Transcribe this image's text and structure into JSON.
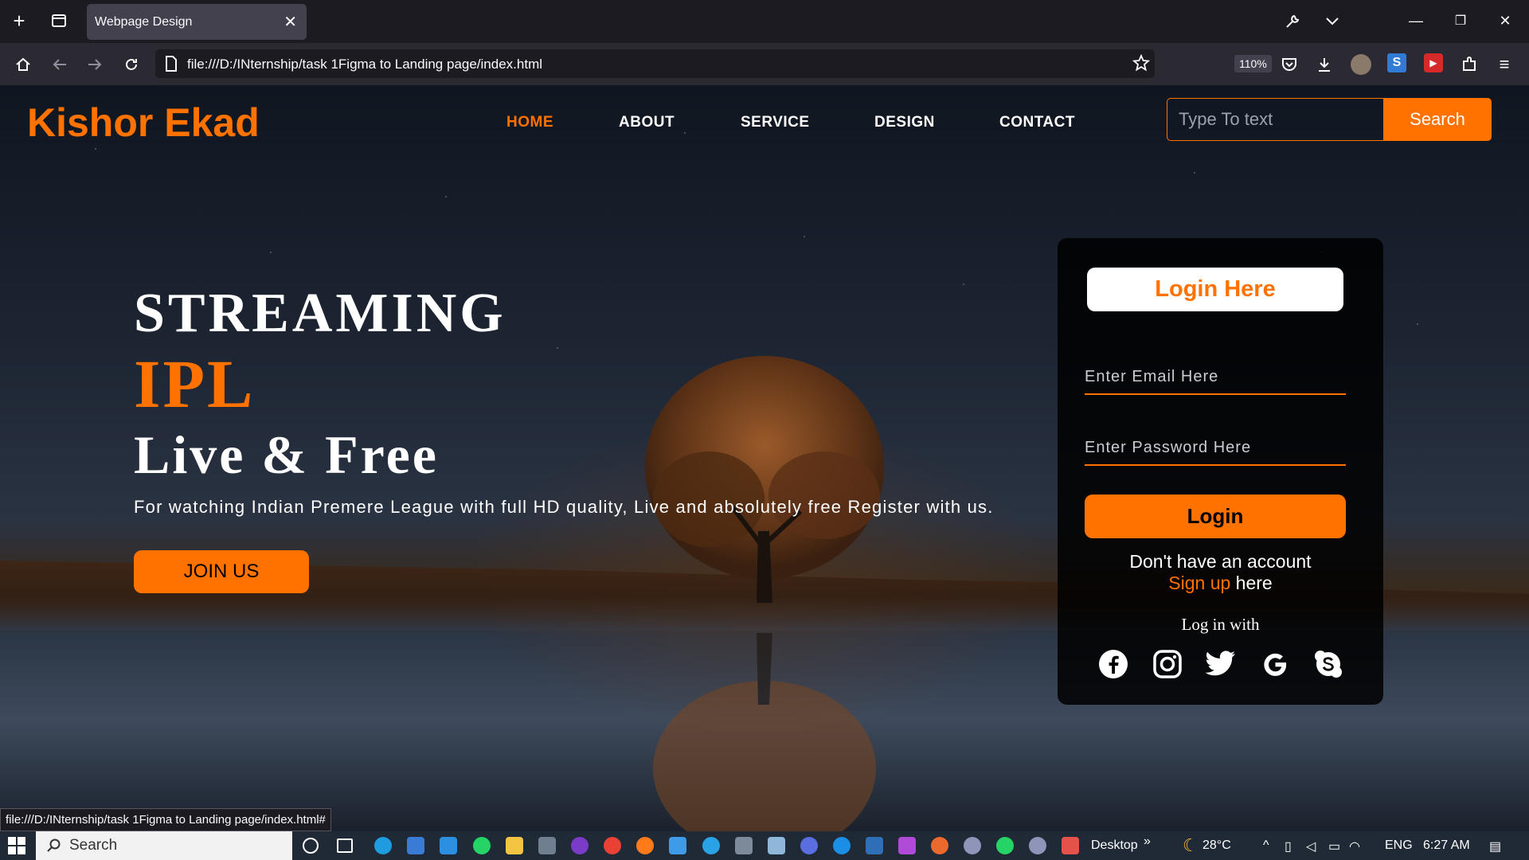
{
  "browser": {
    "tab_title": "Webpage Design",
    "url": "file:///D:/INternship/task 1Figma to Landing page/index.html",
    "zoom": "110%",
    "status_link": "file:///D:/INternship/task 1Figma to Landing page/index.html#"
  },
  "site": {
    "brand": "Kishor Ekad",
    "nav": [
      "HOME",
      "ABOUT",
      "SERVICE",
      "DESIGN",
      "CONTACT"
    ],
    "active_nav": "HOME",
    "search_placeholder": "Type To text",
    "search_button": "Search"
  },
  "hero": {
    "line1": "STREAMING",
    "line2": "IPL",
    "line3": "Live & Free",
    "tagline": "For watching Indian Premere League with full HD quality, Live and absolutely free Register with us.",
    "cta": "JOIN US"
  },
  "login": {
    "title": "Login Here",
    "email_placeholder": "Enter Email Here",
    "password_placeholder": "Enter Password Here",
    "button": "Login",
    "no_account": "Don't have an account",
    "signup_link": "Sign up",
    "signup_suffix": " here",
    "log_in_with": "Log in with",
    "socials": [
      "facebook-icon",
      "instagram-icon",
      "twitter-icon",
      "google-icon",
      "skype-icon"
    ]
  },
  "taskbar": {
    "search": "Search",
    "desktop": "Desktop",
    "temperature": "28°C",
    "language": "ENG",
    "time": "6:27 AM"
  },
  "colors": {
    "accent": "#ff7200",
    "chrome_dark": "#1c1b22",
    "chrome_bar": "#2b2a33"
  }
}
